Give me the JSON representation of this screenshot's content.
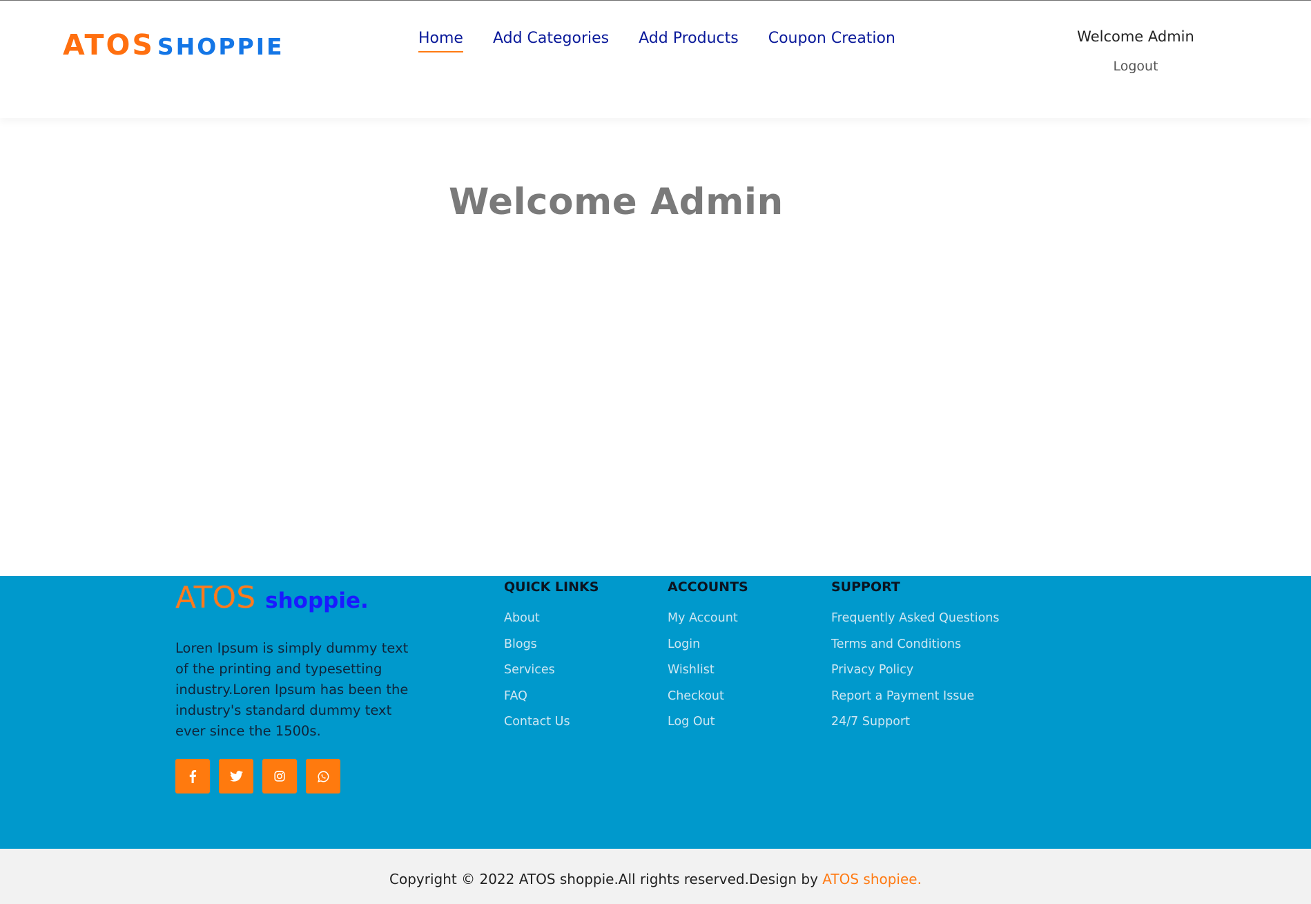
{
  "header": {
    "logo_part1": "ATOS",
    "logo_part2": "SHOPPIE",
    "nav": [
      {
        "label": "Home"
      },
      {
        "label": "Add Categories"
      },
      {
        "label": "Add Products"
      },
      {
        "label": "Coupon Creation"
      }
    ],
    "welcome": "Welcome Admin",
    "logout": "Logout"
  },
  "main": {
    "title": "Welcome Admin"
  },
  "footer": {
    "logo_part1": "ATOS",
    "logo_part2": "shoppie.",
    "description": "Loren Ipsum is simply dummy text of the printing and typesetting industry.Loren Ipsum has been the industry's standard dummy text ever since the 1500s.",
    "socials": [
      "facebook-icon",
      "twitter-icon",
      "instagram-icon",
      "whatsapp-icon"
    ],
    "quick_links": {
      "title": "QUICK LINKS",
      "items": [
        "About",
        "Blogs",
        "Services",
        "FAQ",
        "Contact Us"
      ]
    },
    "accounts": {
      "title": "ACCOUNTS",
      "items": [
        "My Account",
        "Login",
        "Wishlist",
        "Checkout",
        "Log Out"
      ]
    },
    "support": {
      "title": "SUPPORT",
      "items": [
        "Frequently Asked Questions",
        "Terms and Conditions",
        "Privacy Policy",
        "Report a Payment Issue",
        "24/7 Support"
      ]
    }
  },
  "copyright": {
    "text": "Copyright © 2022 ATOS shoppie.All rights reserved.Design by ",
    "brand": "ATOS shopiee."
  },
  "colors": {
    "accent_orange": "#ff7a12",
    "nav_blue": "#0a1a9a",
    "footer_bg": "#0099cc"
  }
}
